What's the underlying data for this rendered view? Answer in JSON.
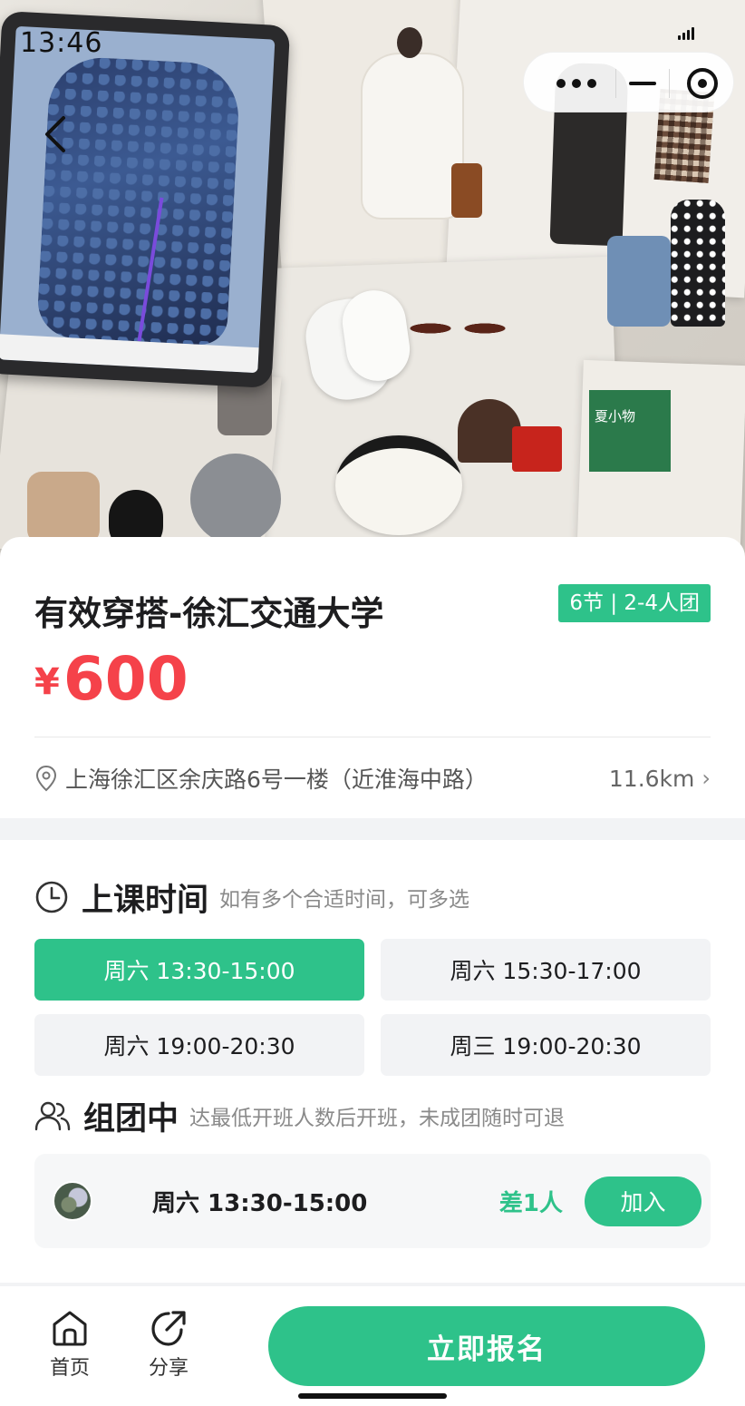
{
  "status_bar": {
    "time": "13:46"
  },
  "capsule": {
    "more_icon": "more-dots-icon",
    "minimize_icon": "minimize-icon",
    "close_icon": "target-close-icon"
  },
  "course": {
    "title": "有效穿搭-徐汇交通大学",
    "badge": "6节 | 2-4人团",
    "currency": "¥",
    "price": "600",
    "address": "上海徐汇区余庆路6号一楼（近淮海中路）",
    "distance": "11.6km"
  },
  "schedule": {
    "title": "上课时间",
    "subtitle": "如有多个合适时间，可多选",
    "slots": [
      {
        "label": "周六 13:30-15:00",
        "selected": true
      },
      {
        "label": "周六 15:30-17:00",
        "selected": false
      },
      {
        "label": "周六 19:00-20:30",
        "selected": false
      },
      {
        "label": "周三 19:00-20:30",
        "selected": false
      }
    ]
  },
  "group": {
    "title": "组团中",
    "subtitle": "达最低开班人数后开班，未成团随时可退",
    "items": [
      {
        "time": "周六 13:30-15:00",
        "need": "差1人",
        "join_label": "加入"
      }
    ]
  },
  "bottom_bar": {
    "home_label": "首页",
    "share_label": "分享",
    "cta_label": "立即报名"
  },
  "colors": {
    "accent": "#2ec28a",
    "price": "#f5424a"
  }
}
